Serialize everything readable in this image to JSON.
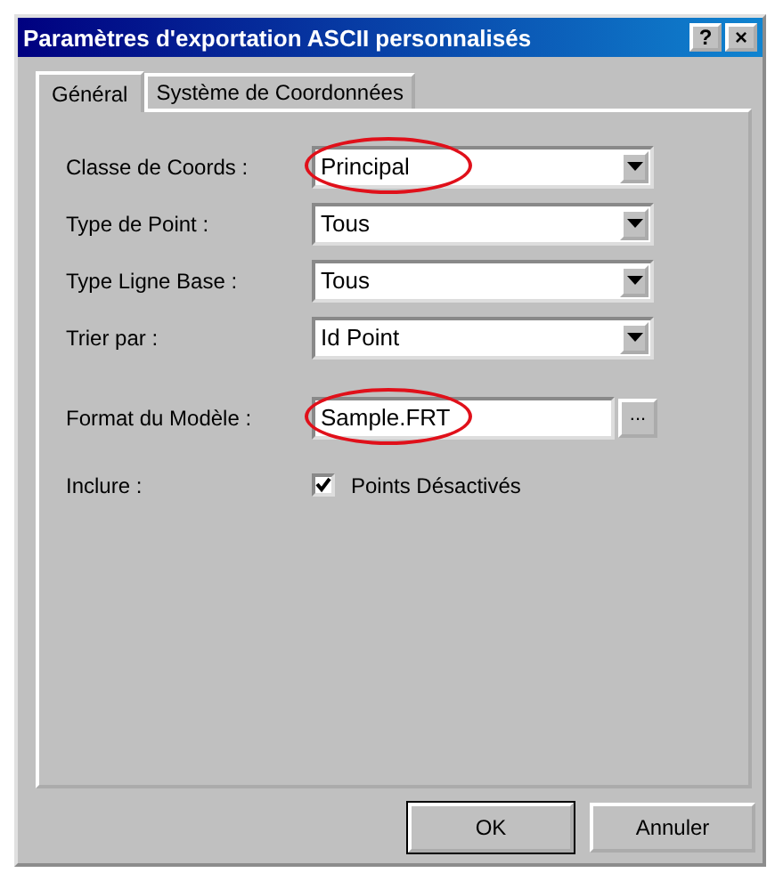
{
  "window": {
    "title": "Paramètres d'exportation ASCII personnalisés",
    "help_button": "?",
    "close_button": "×"
  },
  "tabs": [
    {
      "label": "Général",
      "selected": true
    },
    {
      "label": "Système de Coordonnées",
      "selected": false
    }
  ],
  "fields": [
    {
      "kind": "combo",
      "label": "Classe de Coords :",
      "value": "Principal",
      "highlighted": true
    },
    {
      "kind": "combo",
      "label": "Type de Point :",
      "value": "Tous",
      "highlighted": false
    },
    {
      "kind": "combo",
      "label": "Type Ligne Base :",
      "value": "Tous",
      "highlighted": false
    },
    {
      "kind": "combo",
      "label": "Trier par :",
      "value": "Id Point",
      "highlighted": false
    },
    {
      "kind": "file",
      "label": "Format du Modèle :",
      "value": "Sample.FRT",
      "browse": "...",
      "highlighted": true
    },
    {
      "kind": "checkbox",
      "label": "Inclure :",
      "option": "Points Désactivés",
      "checked": true,
      "highlighted": false
    }
  ],
  "buttons": [
    "OK",
    "Annuler"
  ]
}
